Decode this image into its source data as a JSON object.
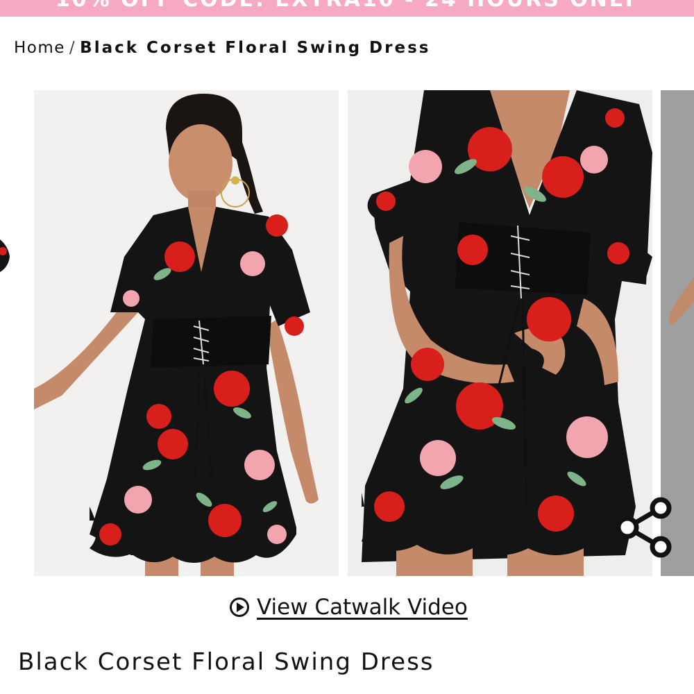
{
  "promo": {
    "text": "10% OFF CODE: EXTRA10 - 24 HOURS ONLY"
  },
  "breadcrumb": {
    "home": "Home",
    "separator": "/",
    "current": "Black Corset Floral Swing Dress"
  },
  "gallery": {
    "images": [
      {
        "subject": "model wearing black floral corset swing dress, front view"
      },
      {
        "subject": "close-up of corset lace-up detail and ruffle hem"
      }
    ]
  },
  "actions": {
    "share_icon": "share-icon",
    "play_icon": "play-circle-icon",
    "catwalk_label": "View Catwalk Video"
  },
  "product": {
    "title": "Black Corset Floral Swing Dress"
  },
  "colors": {
    "promo_bg": "#f7a9c4",
    "text": "#111111",
    "dress": "#141414",
    "flower_red": "#d91f1b",
    "flower_pink": "#f2a5ae",
    "leaf": "#7fb48a"
  }
}
